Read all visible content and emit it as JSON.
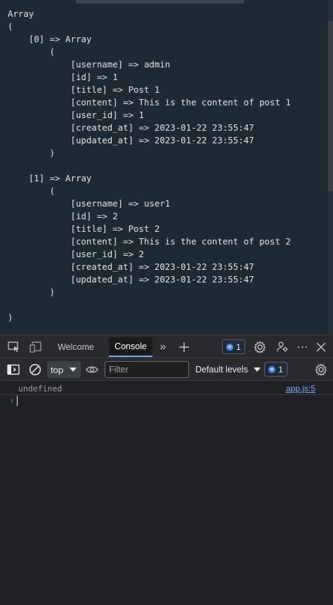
{
  "page": {
    "output_lines": [
      "Array",
      "(",
      "    [0] => Array",
      "        (",
      "            [username] => admin",
      "            [id] => 1",
      "            [title] => Post 1",
      "            [content] => This is the content of post 1",
      "            [user_id] => 1",
      "            [created_at] => 2023-01-22 23:55:47",
      "            [updated_at] => 2023-01-22 23:55:47",
      "        )",
      "",
      "    [1] => Array",
      "        (",
      "            [username] => user1",
      "            [id] => 2",
      "            [title] => Post 2",
      "            [content] => This is the content of post 2",
      "            [user_id] => 2",
      "            [created_at] => 2023-01-22 23:55:47",
      "            [updated_at] => 2023-01-22 23:55:47",
      "        )",
      "",
      ")"
    ]
  },
  "devtools": {
    "tabs": [
      {
        "label": "Welcome",
        "active": false
      },
      {
        "label": "Console",
        "active": true
      }
    ],
    "issues_count": "1",
    "toolbar": {
      "context": "top",
      "filter_placeholder": "Filter",
      "levels_label": "Default levels",
      "issues_count": "1"
    },
    "console": {
      "entries": [
        {
          "value": "undefined",
          "source": "app.js:5"
        }
      ],
      "prompt_symbol": "›"
    }
  },
  "colors": {
    "accent": "#7cacf8",
    "badge_blue": "#4a8af4",
    "page_background": "#1e2a33",
    "devtools_background": "#202124"
  },
  "icons": [
    "inspect-element-icon",
    "device-toggle-icon",
    "more-tabs-chevron-icon",
    "add-tab-plus-icon",
    "issues-message-icon",
    "settings-gear-icon",
    "customize-devtools-icon",
    "kebab-menu-icon",
    "close-icon",
    "sidebar-toggle-icon",
    "clear-console-icon",
    "live-expression-eye-icon"
  ]
}
